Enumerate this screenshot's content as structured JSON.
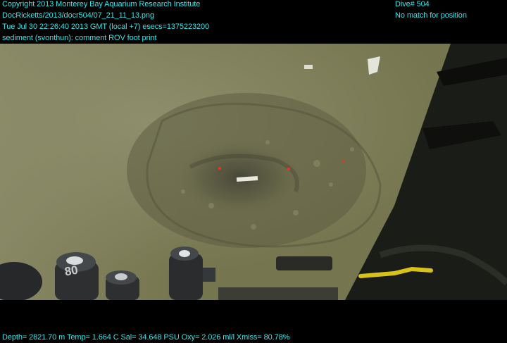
{
  "header": {
    "copyright": "Copyright 2013 Monterey Bay Aquarium Research Institute",
    "filename": "DocRicketts/2013/docr504/07_21_11_13.png",
    "timestamp": "Tue Jul 30 22:26:40 2013 GMT (local +7)  esecs=1375223200",
    "annotation": "sediment (svonthun): comment ROV foot print",
    "dive": "Dive# 504",
    "position": "No match for position"
  },
  "footer": {
    "telemetry": "Depth= 2821.70 m  Temp= 1.664 C  Sal= 34.648 PSU  Oxy= 2.026 ml/l  Xmiss= 80.78%"
  },
  "scene": {
    "camera_label": "80"
  },
  "colors": {
    "overlay_text": "#35e6ea",
    "letterbox": "#000000"
  }
}
